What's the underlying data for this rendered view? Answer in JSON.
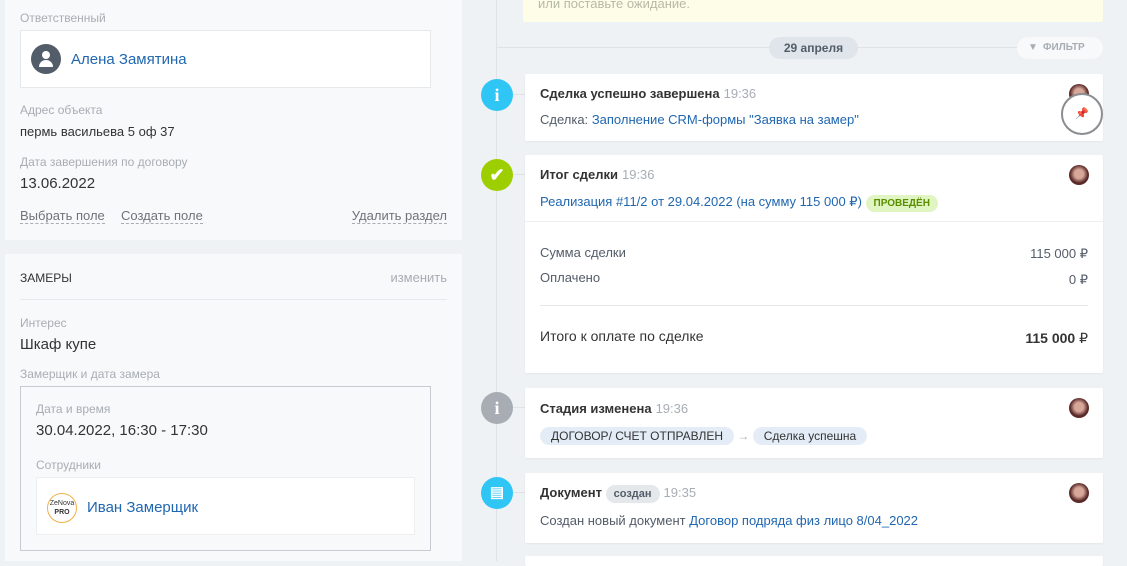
{
  "left": {
    "responsible_label": "Ответственный",
    "responsible_name": "Алена Замятина",
    "address_label": "Адрес объекта",
    "address_value": "пермь васильева 5 оф 37",
    "end_date_label": "Дата завершения по договору",
    "end_date_value": "13.06.2022",
    "select_field": "Выбрать поле",
    "create_field": "Создать поле",
    "delete_section": "Удалить раздел",
    "section_title": "ЗАМЕРЫ",
    "section_edit": "изменить",
    "interest_label": "Интерес",
    "interest_value": "Шкаф купе",
    "measurer_label": "Замерщик и дата замера",
    "datetime_label": "Дата и время",
    "datetime_value": "30.04.2022, 16:30 - 17:30",
    "employees_label": "Сотрудники",
    "employee_name": "Иван Замерщик",
    "employee_logo": "ZeNova PRO"
  },
  "timeline": {
    "notice_text": "или поставьте ожидание.",
    "date_label": "29 апреля",
    "filter_label": "ФИЛЬТР",
    "items": [
      {
        "title": "Сделка успешно завершена",
        "time": "19:36",
        "prefix": "Сделка:",
        "link": "Заполнение CRM-формы \"Заявка на замер\""
      },
      {
        "title": "Итог сделки",
        "time": "19:36",
        "link": "Реализация #11/2 от 29.04.2022 (на сумму 115 000 ₽)",
        "badge": "ПРОВЕДЁН",
        "rows": [
          {
            "label": "Сумма сделки",
            "value": "115 000 ₽"
          },
          {
            "label": "Оплачено",
            "value": "0 ₽"
          }
        ],
        "total_label": "Итого к оплате по сделке",
        "total_value": "115 000",
        " total_currency": "₽",
        "currency": "₽"
      },
      {
        "title": "Стадия изменена",
        "time": "19:36",
        "from": "ДОГОВОР/ СЧЕТ ОТПРАВЛЕН",
        "arrow": "→",
        "to": "Сделка успешна"
      },
      {
        "title": "Документ",
        "badge": "создан",
        "time": "19:35",
        "prefix": "Создан новый документ",
        "link": "Договор подряда физ лицо 8/04_2022"
      }
    ]
  },
  "colors": {
    "info": "#2fc6f6",
    "success": "#9dcf00",
    "neutral": "#a8adb4",
    "link": "#2067b0"
  }
}
